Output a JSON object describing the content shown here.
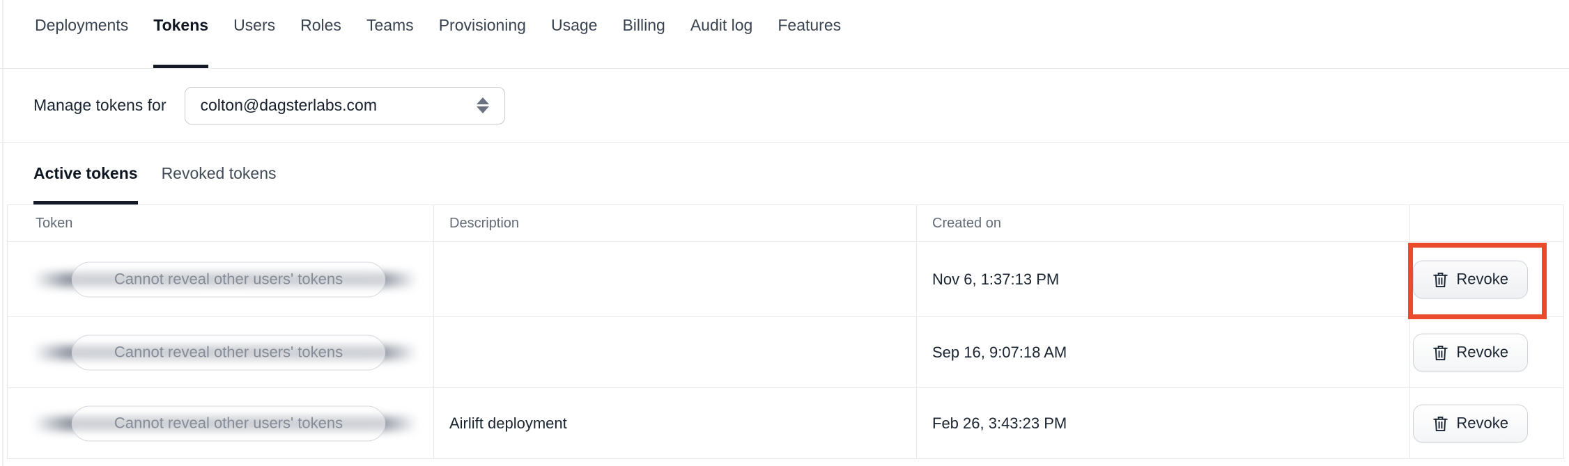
{
  "nav": {
    "tabs": [
      {
        "label": "Deployments"
      },
      {
        "label": "Tokens",
        "active": true
      },
      {
        "label": "Users"
      },
      {
        "label": "Roles"
      },
      {
        "label": "Teams"
      },
      {
        "label": "Provisioning"
      },
      {
        "label": "Usage"
      },
      {
        "label": "Billing"
      },
      {
        "label": "Audit log"
      },
      {
        "label": "Features"
      }
    ]
  },
  "manage": {
    "label": "Manage tokens for",
    "selected_user": "colton@dagsterlabs.com",
    "caret_icon": "up-down-caret-icon"
  },
  "token_tabs": [
    {
      "label": "Active tokens",
      "active": true
    },
    {
      "label": "Revoked tokens"
    }
  ],
  "table": {
    "columns": [
      "Token",
      "Description",
      "Created on",
      ""
    ],
    "rows": [
      {
        "token_masked": true,
        "token_masked_text": "Cannot reveal other users' tokens",
        "description": "",
        "created_on": "Nov 6, 1:37:13 PM",
        "action_label": "Revoke",
        "action_icon": "trash-icon",
        "annotated": true
      },
      {
        "token_masked": true,
        "token_masked_text": "Cannot reveal other users' tokens",
        "description": "",
        "created_on": "Sep 16, 9:07:18 AM",
        "action_label": "Revoke",
        "action_icon": "trash-icon",
        "annotated": false
      },
      {
        "token_masked": true,
        "token_masked_text": "Cannot reveal other users' tokens",
        "description": "Airlift deployment",
        "created_on": "Feb 26, 3:43:23 PM",
        "action_label": "Revoke",
        "action_icon": "trash-icon",
        "annotated": false
      }
    ]
  },
  "colors": {
    "annotation": "#E94B2B",
    "active_underline": "#141B26"
  }
}
